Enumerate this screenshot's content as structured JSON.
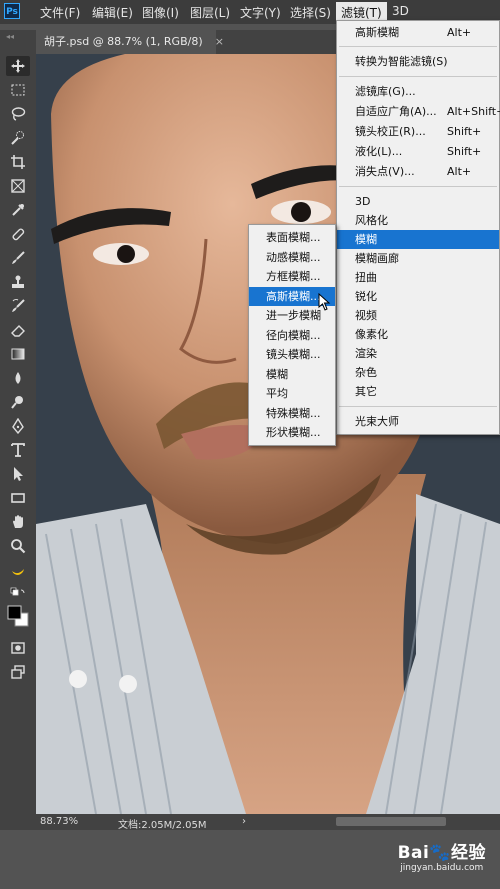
{
  "app": {
    "logo": "Ps"
  },
  "menubar": {
    "items": [
      {
        "label": "文件(F)"
      },
      {
        "label": "编辑(E)"
      },
      {
        "label": "图像(I)"
      },
      {
        "label": "图层(L)"
      },
      {
        "label": "文字(Y)"
      },
      {
        "label": "选择(S)"
      },
      {
        "label": "滤镜(T)"
      },
      {
        "label": "3D"
      }
    ]
  },
  "document_tab": {
    "title": "胡子.psd @ 88.7% (1, RGB/8)",
    "close": "×"
  },
  "tools": [
    "move-icon",
    "marquee-icon",
    "lasso-icon",
    "quick-select-icon",
    "crop-icon",
    "frame-icon",
    "eyedropper-icon",
    "healing-icon",
    "brush-icon",
    "stamp-icon",
    "history-brush-icon",
    "eraser-icon",
    "gradient-icon",
    "blur-icon",
    "dodge-icon",
    "pen-icon",
    "type-icon",
    "path-select-icon",
    "rectangle-icon",
    "hand-icon",
    "zoom-icon",
    "banana-icon",
    "default-colors-icon",
    "quick-mask-icon",
    "screen-mode-icon"
  ],
  "filter_menu": {
    "items": [
      {
        "label": "高斯模糊",
        "shortcut": "Alt+"
      },
      {
        "label": "转换为智能滤镜(S)",
        "shortcut": ""
      },
      {
        "label": "滤镜库(G)...",
        "shortcut": ""
      },
      {
        "label": "自适应广角(A)...",
        "shortcut": "Alt+Shift+"
      },
      {
        "label": "镜头校正(R)...",
        "shortcut": "Shift+"
      },
      {
        "label": "液化(L)...",
        "shortcut": "Shift+"
      },
      {
        "label": "消失点(V)...",
        "shortcut": "Alt+"
      },
      {
        "label": "3D",
        "shortcut": ""
      },
      {
        "label": "风格化",
        "shortcut": ""
      },
      {
        "label": "模糊",
        "shortcut": ""
      },
      {
        "label": "模糊画廊",
        "shortcut": ""
      },
      {
        "label": "扭曲",
        "shortcut": ""
      },
      {
        "label": "锐化",
        "shortcut": ""
      },
      {
        "label": "视频",
        "shortcut": ""
      },
      {
        "label": "像素化",
        "shortcut": ""
      },
      {
        "label": "渲染",
        "shortcut": ""
      },
      {
        "label": "杂色",
        "shortcut": ""
      },
      {
        "label": "其它",
        "shortcut": ""
      },
      {
        "label": "光束大师",
        "shortcut": ""
      }
    ]
  },
  "blur_submenu": {
    "items": [
      {
        "label": "表面模糊..."
      },
      {
        "label": "动感模糊..."
      },
      {
        "label": "方框模糊..."
      },
      {
        "label": "高斯模糊..."
      },
      {
        "label": "进一步模糊"
      },
      {
        "label": "径向模糊..."
      },
      {
        "label": "镜头模糊..."
      },
      {
        "label": "模糊"
      },
      {
        "label": "平均"
      },
      {
        "label": "特殊模糊..."
      },
      {
        "label": "形状模糊..."
      }
    ],
    "highlighted": "高斯模糊..."
  },
  "status": {
    "zoom": "88.73%",
    "doc_size": "文档:2.05M/2.05M",
    "arrow": "›"
  },
  "watermark": {
    "logo": "Bai🐾经验",
    "url": "jingyan.baidu.com"
  },
  "colors": {
    "highlight": "#1874d0",
    "menu_bg": "#f0f0f0",
    "panel": "#424242"
  }
}
